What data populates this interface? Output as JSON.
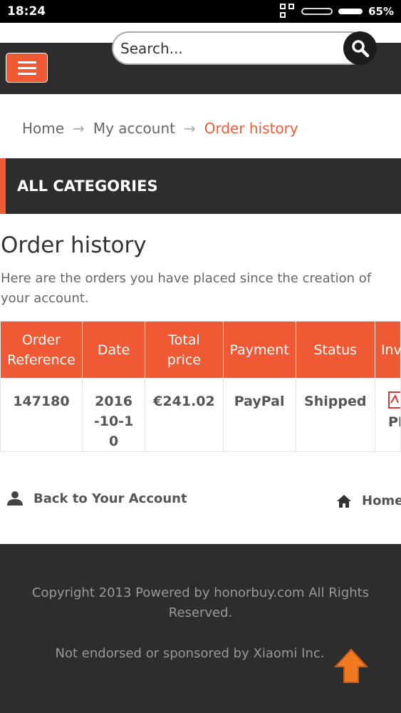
{
  "status_bar": {
    "time": "18:24",
    "battery": "65%",
    "icons": [
      "qr-icon",
      "signal-icon",
      "battery-icon"
    ]
  },
  "header": {
    "menu_icon": "hamburger-icon",
    "search": {
      "placeholder": "Search...",
      "icon": "search-icon"
    }
  },
  "breadcrumb": {
    "items": [
      "Home",
      "My account",
      "Order history"
    ],
    "separator": "→"
  },
  "categories": {
    "label": "ALL CATEGORIES"
  },
  "main": {
    "title": "Order history",
    "description": "Here are the orders you have placed since the creation of your account.",
    "table": {
      "headers": [
        "Order Reference",
        "Date",
        "Total price",
        "Payment",
        "Status",
        "Invoice"
      ],
      "rows": [
        {
          "reference": "147180",
          "date": "2016-10-10",
          "total": "€241.02",
          "payment": "PayPal",
          "status": "Shipped",
          "invoice": "PDF"
        }
      ]
    },
    "back_link": "Back to Your Account",
    "home_link": "Home"
  },
  "footer": {
    "copyright": "Copyright 2013 Powered by honorbuy.com All Rights Reserved.",
    "disclaimer": "Not endorsed or sponsored by Xiaomi Inc."
  },
  "colors": {
    "accent": "#ef5a35",
    "dark": "#2d2d2d"
  }
}
